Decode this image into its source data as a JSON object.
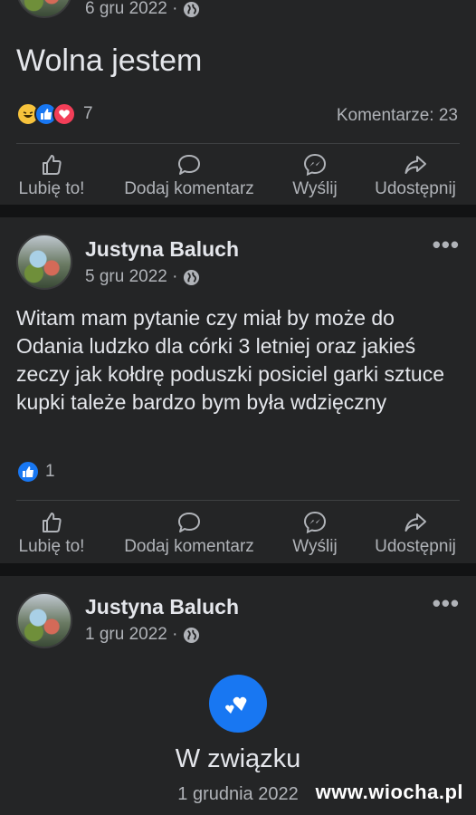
{
  "post1": {
    "date": "6 gru 2022 ·",
    "text": "Wolna jestem",
    "reaction_count": "7",
    "comments": "Komentarze: 23"
  },
  "post2": {
    "author": "Justyna Baluch",
    "date": "5 gru 2022 ·",
    "text": "Witam mam pytanie czy miał by może do Odania ludzko dla córki 3 letniej oraz jakieś zeczy jak kołdrę poduszki posiciel  garki sztuce kupki tależe bardzo bym była wdzięczny",
    "reaction_count": "1"
  },
  "post3": {
    "author": "Justyna Baluch",
    "date": "1 gru 2022 ·",
    "life_event": "W związku",
    "life_event_date": "1 grudnia 2022"
  },
  "actions": {
    "like": "Lubię to!",
    "comment": "Dodaj komentarz",
    "send": "Wyślij",
    "share": "Udostępnij"
  },
  "watermark": "www.wiocha.pl",
  "icons": {
    "like": "thumbs-up-icon",
    "comment": "speech-bubble-icon",
    "send": "messenger-icon",
    "share": "share-arrow-icon",
    "privacy": "globe-icon",
    "more": "more-dots-icon"
  },
  "colors": {
    "background": "#18191a",
    "card": "#242526",
    "accent": "#1877f2",
    "muted_text": "#b0b3b8"
  }
}
